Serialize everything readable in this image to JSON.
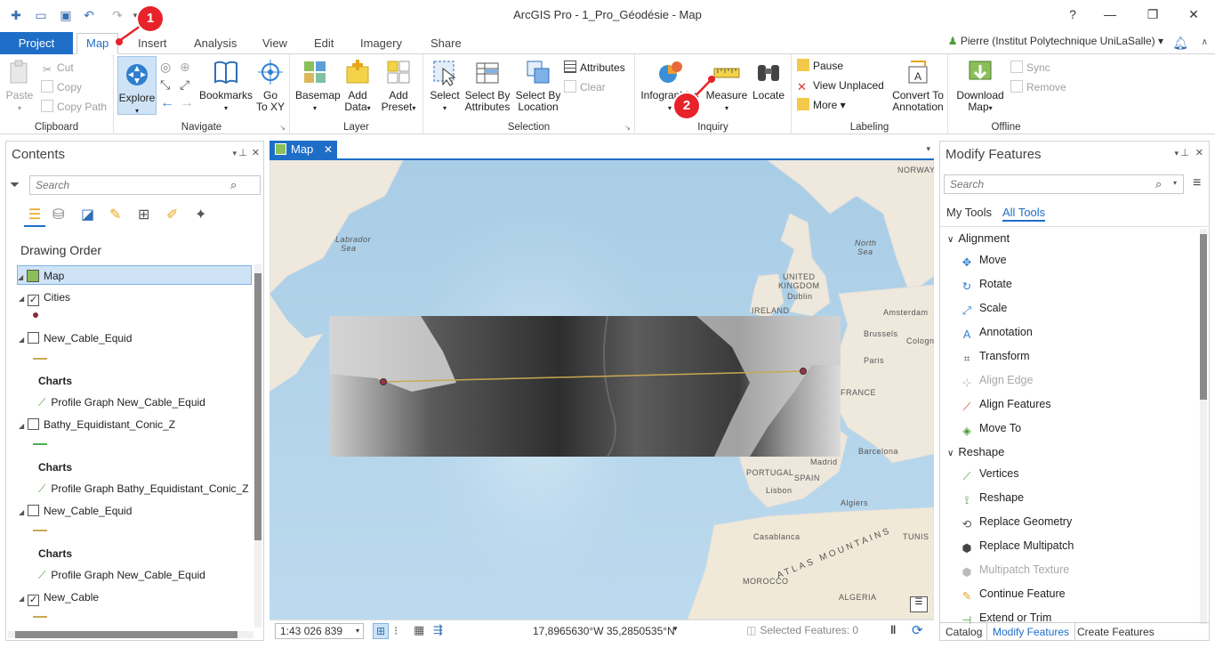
{
  "app": {
    "title": "ArcGIS Pro - 1_Pro_Géodésie - Map",
    "user": "Pierre (Institut Polytechnique UniLaSalle)",
    "help": "?"
  },
  "ribbon_tabs": [
    "Project",
    "Map",
    "Insert",
    "Analysis",
    "View",
    "Edit",
    "Imagery",
    "Share"
  ],
  "ribbon": {
    "clipboard": {
      "label": "Clipboard",
      "paste": "Paste",
      "cut": "Cut",
      "copy": "Copy",
      "copy_path": "Copy Path"
    },
    "navigate": {
      "label": "Navigate",
      "explore": "Explore",
      "bookmarks": "Bookmarks",
      "goto": "Go",
      "goto2": "To XY"
    },
    "layer": {
      "label": "Layer",
      "basemap": "Basemap",
      "add_data": "Add",
      "add_data2": "Data",
      "add_preset": "Add",
      "add_preset2": "Preset"
    },
    "selection": {
      "label": "Selection",
      "select": "Select",
      "select_attr": "Select By",
      "select_attr2": "Attributes",
      "select_loc": "Select By",
      "select_loc2": "Location",
      "attributes": "Attributes",
      "clear": "Clear"
    },
    "inquiry": {
      "label": "Inquiry",
      "infographics": "Infographics",
      "measure": "Measure",
      "locate": "Locate"
    },
    "labeling": {
      "label": "Labeling",
      "pause": "Pause",
      "view_unplaced": "View Unplaced",
      "more": "More",
      "convert": "Convert To",
      "convert2": "Annotation"
    },
    "offline": {
      "label": "Offline",
      "download": "Download",
      "download2": "Map",
      "sync": "Sync",
      "remove": "Remove"
    }
  },
  "contents": {
    "title": "Contents",
    "search_placeholder": "Search",
    "drawing_order": "Drawing Order",
    "map_name": "Map",
    "layers": [
      {
        "name": "Cities",
        "checked": true
      },
      {
        "name": "New_Cable_Equid",
        "checked": false,
        "chart_header": "Charts",
        "chart": "Profile Graph New_Cable_Equid"
      },
      {
        "name": "Bathy_Equidistant_Conic_Z",
        "checked": false,
        "chart_header": "Charts",
        "chart": "Profile Graph Bathy_Equidistant_Conic_Z"
      },
      {
        "name": "New_Cable_Equid",
        "checked": false,
        "chart_header": "Charts",
        "chart": "Profile Graph New_Cable_Equid"
      },
      {
        "name": "New_Cable",
        "checked": true
      }
    ]
  },
  "map": {
    "tab": "Map",
    "scale": "1:43 026 839",
    "coords": "17,8965630°W 35,2850535°N",
    "selected": "Selected Features: 0",
    "labels": {
      "norway": "NORWAY",
      "labrador": "Labrador",
      "labrador2": "Sea",
      "north_sea": "North",
      "north_sea2": "Sea",
      "uk": "UNITED",
      "uk2": "KINGDOM",
      "dublin": "Dublin",
      "ireland": "IRELAND",
      "amsterdam": "Amsterdam",
      "brussels": "Brussels",
      "cologne": "Cologne",
      "paris": "Paris",
      "france": "FRANCE",
      "madrid": "Madrid",
      "portugal": "PORTUGAL",
      "spain": "SPAIN",
      "lisbon": "Lisbon",
      "barcelona": "Barcelona",
      "algiers": "Algiers",
      "tunis": "TUNIS",
      "casablanca": "Casablanca",
      "atlas": "ATLAS MOUNTAINS",
      "morocco": "MOROCCO",
      "algeria": "ALGERIA"
    }
  },
  "modify": {
    "title": "Modify Features",
    "search_placeholder": "Search",
    "tab_my": "My Tools",
    "tab_all": "All Tools",
    "sections": [
      {
        "name": "Alignment",
        "tools": [
          {
            "name": "Move",
            "enabled": true
          },
          {
            "name": "Rotate",
            "enabled": true
          },
          {
            "name": "Scale",
            "enabled": true
          },
          {
            "name": "Annotation",
            "enabled": true
          },
          {
            "name": "Transform",
            "enabled": true
          },
          {
            "name": "Align Edge",
            "enabled": false
          },
          {
            "name": "Align Features",
            "enabled": true
          },
          {
            "name": "Move To",
            "enabled": true
          }
        ]
      },
      {
        "name": "Reshape",
        "tools": [
          {
            "name": "Vertices",
            "enabled": true
          },
          {
            "name": "Reshape",
            "enabled": true
          },
          {
            "name": "Replace Geometry",
            "enabled": true
          },
          {
            "name": "Replace Multipatch",
            "enabled": true
          },
          {
            "name": "Multipatch Texture",
            "enabled": false
          },
          {
            "name": "Continue Feature",
            "enabled": true
          },
          {
            "name": "Extend or Trim",
            "enabled": true
          }
        ]
      }
    ],
    "bottom_tabs": [
      "Catalog",
      "Modify Features",
      "Create Features"
    ]
  },
  "annotations": {
    "badge1": "1",
    "badge2": "2"
  },
  "colors": {
    "accent": "#1e6ec8",
    "badge": "#e8222a"
  }
}
